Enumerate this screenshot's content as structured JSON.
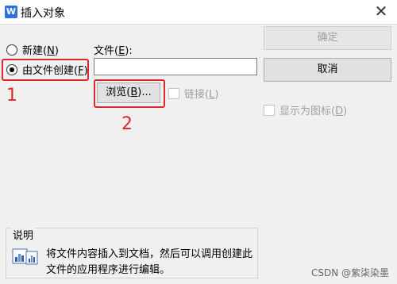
{
  "window": {
    "title": "插入对象",
    "app_icon_glyph": "W",
    "close_glyph": "✕"
  },
  "options": {
    "new_label": "新建(",
    "new_key": "N",
    "from_file_label": "由文件创建(",
    "from_file_key": "F",
    "selected": "from_file"
  },
  "file": {
    "label": "文件(",
    "label_key": "E",
    "label_suffix": "):",
    "value": ""
  },
  "buttons": {
    "ok_label": "确定",
    "cancel_label": "取消",
    "browse_label": "浏览(",
    "browse_key": "B",
    "browse_suffix": ")..."
  },
  "link": {
    "label": "链接(",
    "key": "L",
    "suffix": ")"
  },
  "display_as_icon": {
    "label": "显示为图标(",
    "key": "D",
    "suffix": ")"
  },
  "annotations": {
    "step1": "1",
    "step2": "2",
    "color": "#e0262c"
  },
  "description": {
    "title": "说明",
    "text": "将文件内容插入到文档，然后可以调用创建此文件的应用程序进行编辑。",
    "icon": "object-file-icon"
  },
  "watermark": "CSDN @紫柒染墨"
}
